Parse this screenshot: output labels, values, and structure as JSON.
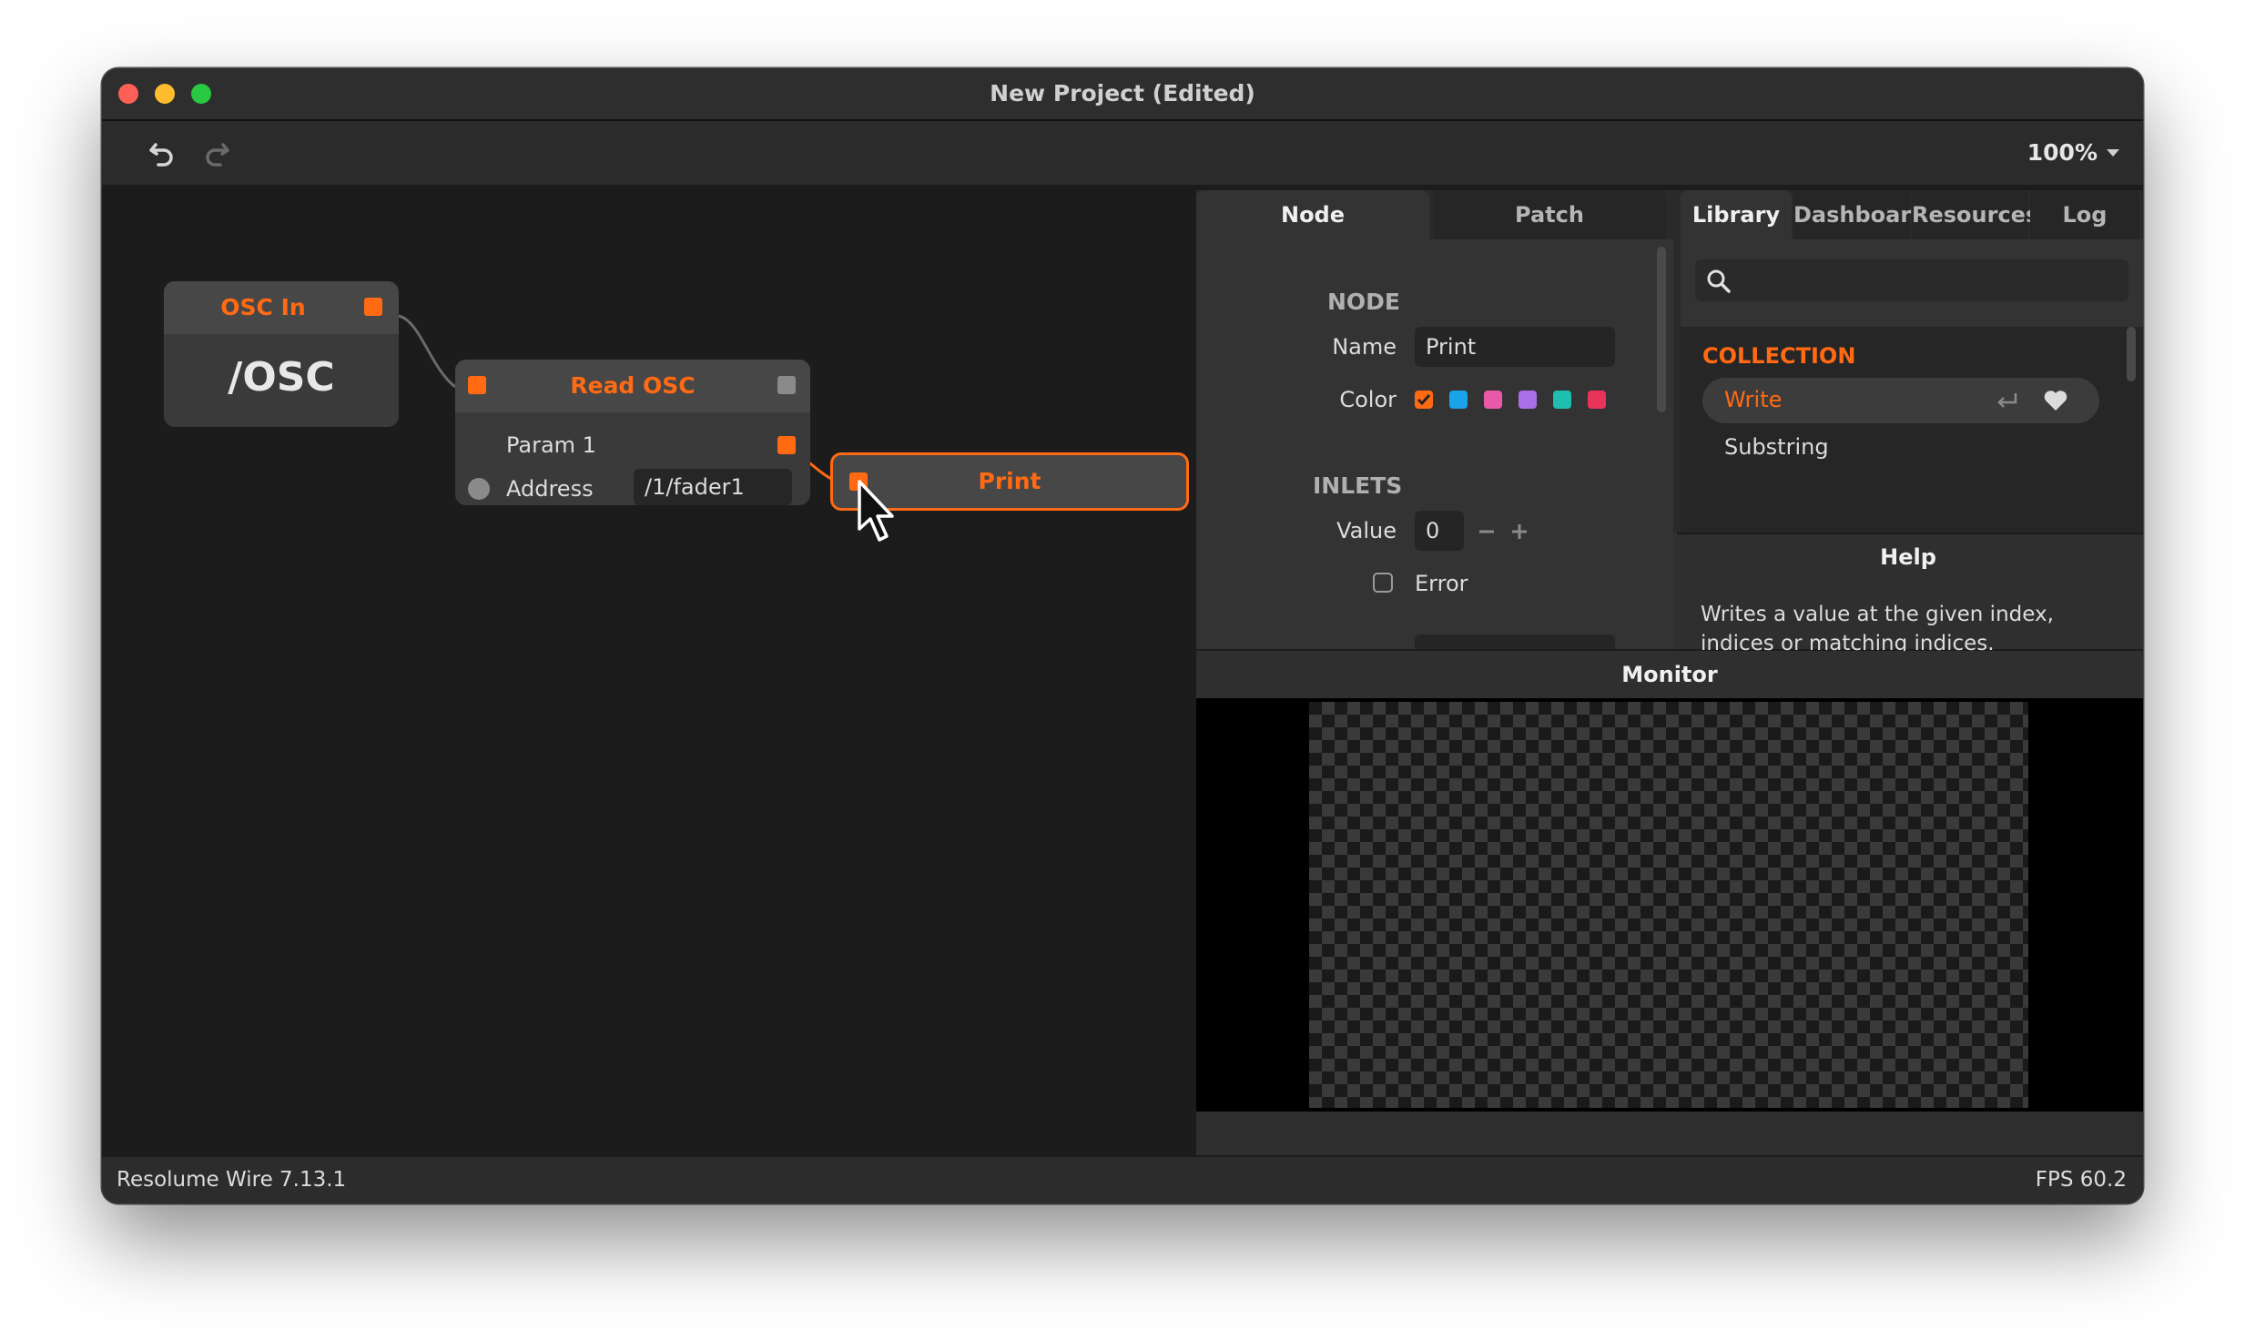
{
  "window": {
    "title": "New Project (Edited)"
  },
  "toolbar": {
    "undo_icon": "undo-icon",
    "redo_icon": "redo-icon",
    "zoom": "100%"
  },
  "graph": {
    "nodes": {
      "osc_in": {
        "title": "OSC In",
        "value": "/OSC"
      },
      "read_osc": {
        "title": "Read OSC",
        "param_label": "Param 1",
        "address_label": "Address",
        "address_value": "/1/fader1"
      },
      "print": {
        "title": "Print"
      }
    },
    "accent_color": "#ff6a13"
  },
  "inspector": {
    "tabs": [
      "Node",
      "Patch"
    ],
    "active_tab": "Node",
    "node_section": "NODE",
    "name_label": "Name",
    "name_value": "Print",
    "color_label": "Color",
    "colors": [
      "#ff6a13",
      "#1aa3e8",
      "#e85aa8",
      "#a96ee8",
      "#1fbfb0",
      "#e8335a"
    ],
    "inlets_section": "INLETS",
    "value_label": "Value",
    "value_value": "0",
    "error_label": "Error"
  },
  "library": {
    "tabs": [
      "Library",
      "Dashboard",
      "Resources",
      "Log"
    ],
    "active_tab": "Library",
    "search_placeholder": "",
    "collection_header": "COLLECTION",
    "items": [
      "Write",
      "Substring"
    ],
    "selected_item": "Write"
  },
  "help": {
    "title": "Help",
    "text": "Writes a value at the given index, indices or matching indices."
  },
  "monitor": {
    "title": "Monitor"
  },
  "status": {
    "app_version": "Resolume Wire 7.13.1",
    "fps": "FPS 60.2"
  }
}
